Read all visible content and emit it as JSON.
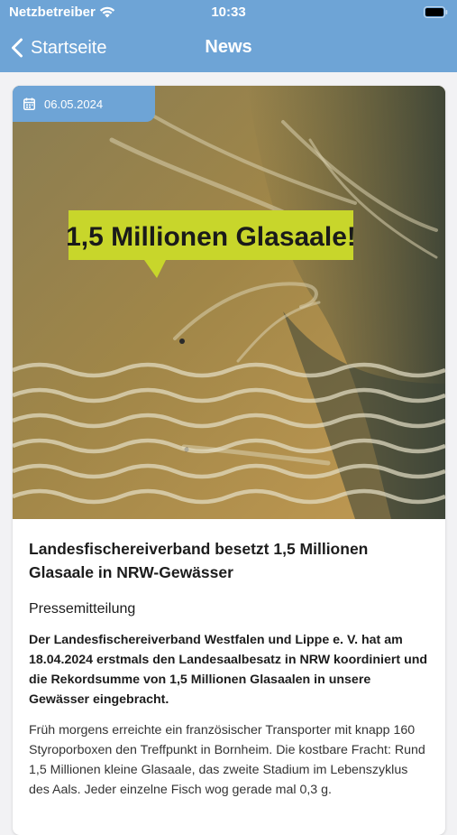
{
  "status_bar": {
    "carrier": "Netzbetreiber",
    "time": "10:33"
  },
  "nav": {
    "back_label": "Startseite",
    "title": "News"
  },
  "colors": {
    "accent": "#6ea4d6",
    "speech_bubble": "#c8d62b"
  },
  "article": {
    "date": "06.05.2024",
    "image_caption": "1,5 Millionen Glasaale!",
    "title": "Landesfischereiverband besetzt 1,5 Millionen Glasaale in NRW-Gewässer",
    "category": "Pressemitteilung",
    "lead": "Der Landesfischereiverband Westfalen und Lippe e. V. hat am 18.04.2024 erstmals den Landesaalbesatz in NRW koordiniert und die Rekordsumme von 1,5 Millionen Glasaalen in unsere Gewässer eingebracht.",
    "body": "Früh morgens erreichte ein französischer Transporter mit knapp 160 Styroporboxen den Treffpunkt in Bornheim. Die kostbare Fracht: Rund 1,5 Millionen kleine Glasaale, das zweite Stadium im Lebenszyklus des Aals. Jeder einzelne Fisch wog gerade mal 0,3 g."
  }
}
